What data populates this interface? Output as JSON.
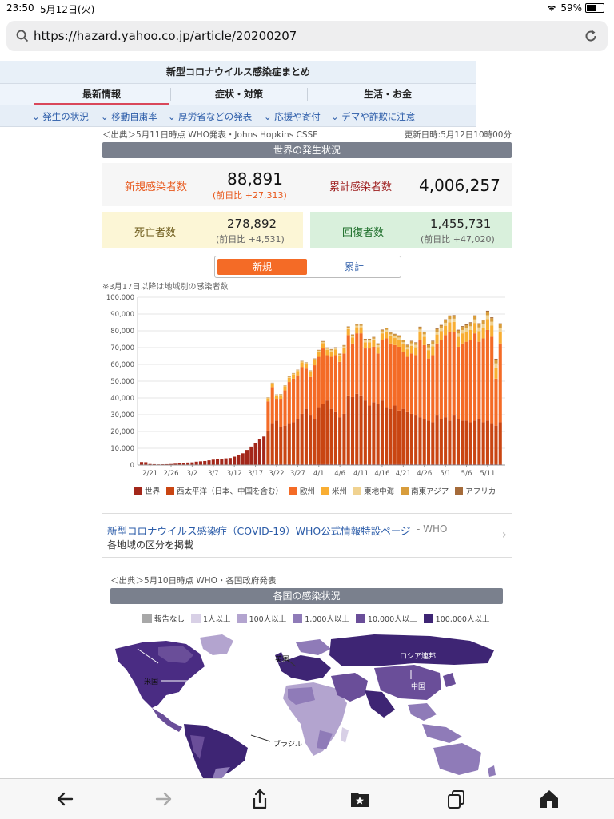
{
  "status": {
    "time": "23:50",
    "date": "5月12日(火)",
    "battery": "59%"
  },
  "url": "https://hazard.yahoo.co.jp/article/20200207",
  "nav": {
    "title": "新型コロナウイルス感染症まとめ",
    "tabs": [
      "最新情報",
      "症状・対策",
      "生活・お金"
    ],
    "subnav": [
      "発生の状況",
      "移動自粛率",
      "厚労省などの発表",
      "応援や寄付",
      "デマや詐欺に注意"
    ]
  },
  "world": {
    "source": "＜出典＞5月11日時点 WHO発表・Johns Hopkins CSSE",
    "updated": "更新日時:5月12日10時00分",
    "section_title": "世界の発生状況",
    "new_cases_label": "新規感染者数",
    "new_cases": "88,891",
    "new_cases_diff": "(前日比 +27,313)",
    "total_cases_label": "累計感染者数",
    "total_cases": "4,006,257",
    "deaths_label": "死亡者数",
    "deaths": "278,892",
    "deaths_diff": "(前日比 +4,531)",
    "recovered_label": "回復者数",
    "recovered": "1,455,731",
    "recovered_diff": "(前日比 +47,020)",
    "toggle_new": "新規",
    "toggle_total": "累計",
    "chart_note": "※3月17日以降は地域別の感染者数"
  },
  "chart_data": {
    "type": "bar",
    "stacked": true,
    "yticks": [
      "100,000",
      "90,000",
      "80,000",
      "70,000",
      "60,000",
      "50,000",
      "40,000",
      "30,000",
      "20,000",
      "10,000",
      "0"
    ],
    "ylim": [
      0,
      100000
    ],
    "xticks": [
      "2/21",
      "2/26",
      "3/2",
      "3/7",
      "3/12",
      "3/17",
      "3/22",
      "3/27",
      "4/1",
      "4/6",
      "4/11",
      "4/16",
      "4/21",
      "4/26",
      "5/1",
      "5/6",
      "5/11"
    ],
    "colors": {
      "world": "#a3271a",
      "west": "#c94512",
      "europe": "#f46b26",
      "americas": "#f9ae33",
      "emed": "#f0d290",
      "seasia": "#d89d3c",
      "africa": "#a56b3a"
    },
    "legend": [
      "世界",
      "西太平洋（日本、中国を含む）",
      "欧州",
      "米州",
      "東地中海",
      "南東アジア",
      "アフリカ"
    ],
    "world_before_317": [
      1800,
      1700,
      600,
      500,
      400,
      450,
      500,
      600,
      800,
      1000,
      1200,
      1500,
      1600,
      2000,
      2200,
      2400,
      2800,
      3200,
      3500,
      3800,
      4000,
      4200,
      5000,
      6200,
      7000,
      9000,
      11000,
      13000,
      15500,
      17000
    ],
    "stacked_from_317": [
      [
        500,
        20000,
        17500,
        1800,
        200,
        200,
        100
      ],
      [
        500,
        24000,
        22000,
        2000,
        300,
        200,
        100
      ],
      [
        500,
        26000,
        13000,
        2000,
        300,
        200,
        100
      ],
      [
        500,
        22000,
        17000,
        2200,
        300,
        200,
        100
      ],
      [
        500,
        23000,
        21000,
        2400,
        300,
        200,
        100
      ],
      [
        500,
        24000,
        25000,
        2500,
        400,
        300,
        100
      ],
      [
        500,
        25000,
        26000,
        2500,
        400,
        300,
        100
      ],
      [
        500,
        27000,
        26000,
        2600,
        400,
        300,
        100
      ],
      [
        500,
        30000,
        28000,
        2800,
        400,
        300,
        150
      ],
      [
        500,
        33000,
        24000,
        2800,
        500,
        300,
        150
      ],
      [
        500,
        29000,
        23000,
        3000,
        500,
        300,
        150
      ],
      [
        500,
        27000,
        32000,
        3000,
        500,
        400,
        150
      ],
      [
        500,
        34000,
        30000,
        3000,
        600,
        400,
        150
      ],
      [
        500,
        36000,
        33000,
        3200,
        600,
        400,
        200
      ],
      [
        500,
        38000,
        27000,
        3200,
        700,
        500,
        200
      ],
      [
        500,
        33000,
        31000,
        3200,
        700,
        500,
        200
      ],
      [
        500,
        31000,
        34000,
        3300,
        700,
        500,
        200
      ],
      [
        500,
        28000,
        33000,
        3300,
        800,
        600,
        200
      ],
      [
        500,
        30000,
        36000,
        3400,
        800,
        600,
        200
      ],
      [
        500,
        41000,
        36000,
        3500,
        800,
        600,
        200
      ],
      [
        500,
        40000,
        32000,
        3500,
        900,
        700,
        200
      ],
      [
        500,
        42000,
        36000,
        3600,
        900,
        700,
        200
      ],
      [
        500,
        41000,
        37000,
        3600,
        900,
        700,
        250
      ],
      [
        500,
        38000,
        31000,
        3700,
        1000,
        800,
        250
      ],
      [
        500,
        35000,
        34000,
        3700,
        1000,
        800,
        250
      ],
      [
        500,
        37000,
        33000,
        3800,
        1000,
        800,
        250
      ],
      [
        500,
        36000,
        30000,
        3900,
        1000,
        900,
        250
      ],
      [
        500,
        38000,
        36000,
        4000,
        1100,
        900,
        250
      ],
      [
        500,
        34000,
        41000,
        4000,
        1100,
        900,
        300
      ],
      [
        500,
        33000,
        39000,
        4200,
        1200,
        1000,
        300
      ],
      [
        500,
        35000,
        36000,
        4200,
        1200,
        1000,
        300
      ],
      [
        500,
        32000,
        38000,
        4300,
        1200,
        1000,
        300
      ],
      [
        500,
        33000,
        34000,
        4400,
        1300,
        1100,
        300
      ],
      [
        500,
        31000,
        33000,
        4500,
        1300,
        1100,
        300
      ],
      [
        500,
        30000,
        36000,
        4600,
        1400,
        1200,
        350
      ],
      [
        500,
        29000,
        36000,
        4700,
        1400,
        1200,
        350
      ],
      [
        500,
        28000,
        46000,
        4800,
        1500,
        1300,
        350
      ],
      [
        500,
        27000,
        44000,
        4900,
        1500,
        1300,
        350
      ],
      [
        500,
        26000,
        37000,
        5000,
        1600,
        1400,
        400
      ],
      [
        500,
        25000,
        40000,
        5200,
        1600,
        1400,
        400
      ],
      [
        500,
        29000,
        43000,
        5300,
        1700,
        1500,
        400
      ],
      [
        500,
        27000,
        47000,
        5400,
        1700,
        1500,
        400
      ],
      [
        500,
        28000,
        49000,
        5500,
        1800,
        1600,
        450
      ],
      [
        500,
        26000,
        53000,
        5600,
        1900,
        1700,
        450
      ],
      [
        500,
        29000,
        50000,
        5800,
        1900,
        1700,
        450
      ],
      [
        500,
        27000,
        43000,
        5900,
        2000,
        1800,
        450
      ],
      [
        500,
        26000,
        46000,
        6000,
        2000,
        1800,
        500
      ],
      [
        500,
        26000,
        47000,
        6000,
        2000,
        1800,
        500
      ],
      [
        500,
        25000,
        49000,
        6100,
        2100,
        1900,
        500
      ],
      [
        500,
        26000,
        52000,
        6200,
        2100,
        1900,
        500
      ],
      [
        500,
        27000,
        46000,
        6300,
        2200,
        2000,
        500
      ],
      [
        500,
        25000,
        50000,
        6400,
        2200,
        2000,
        500
      ],
      [
        500,
        26000,
        54000,
        6500,
        2300,
        2100,
        550
      ],
      [
        500,
        24000,
        52000,
        6600,
        2300,
        2100,
        550
      ],
      [
        500,
        23000,
        28000,
        6700,
        2400,
        2200,
        550
      ],
      [
        500,
        25000,
        47000,
        6800,
        2400,
        2200,
        550
      ]
    ]
  },
  "link": {
    "text": "新型コロナウイルス感染症（COVID-19）WHO公式情報特設ページ",
    "source": "- WHO",
    "sub": "各地域の区分を掲載"
  },
  "countries": {
    "source": "＜出典＞5月10日時点 WHO・各国政府発表",
    "section_title": "各国の感染状況",
    "legend": [
      "報告なし",
      "1人以上",
      "100人以上",
      "1,000人以上",
      "10,000人以上",
      "100,000人以上"
    ],
    "legend_colors": [
      "#a8a8a8",
      "#d8d0e6",
      "#b3a4cf",
      "#8f7bb8",
      "#6a4e99",
      "#3e2574"
    ],
    "map_labels": [
      "英国",
      "ロシア連邦",
      "米国",
      "中国",
      "ブラジル"
    ]
  }
}
